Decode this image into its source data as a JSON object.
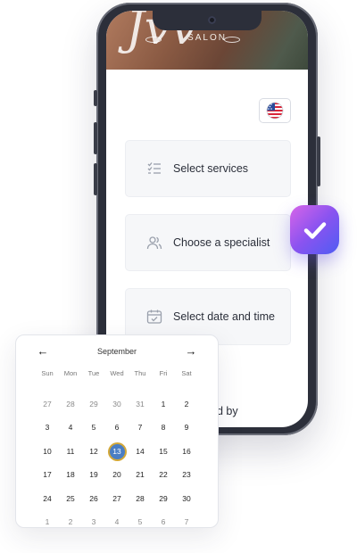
{
  "banner": {
    "script_text": "Jvv",
    "brand": "SALON"
  },
  "steps": [
    {
      "label": "Select services",
      "icon": "list-check-icon"
    },
    {
      "label": "Choose a specialist",
      "icon": "users-icon"
    },
    {
      "label": "Select date and time",
      "icon": "calendar-check-icon"
    }
  ],
  "footer_partial": "d by",
  "language": {
    "flag": "us-flag-icon"
  },
  "calendar": {
    "month": "September",
    "prev": "←",
    "next": "→",
    "weekdays": [
      "Sun",
      "Mon",
      "Tue",
      "Wed",
      "Thu",
      "Fri",
      "Sat"
    ],
    "weeks": [
      [
        {
          "d": "27",
          "m": true
        },
        {
          "d": "28",
          "m": true
        },
        {
          "d": "29",
          "m": true
        },
        {
          "d": "30",
          "m": true
        },
        {
          "d": "31",
          "m": true
        },
        {
          "d": "1"
        },
        {
          "d": "2"
        }
      ],
      [
        {
          "d": "3"
        },
        {
          "d": "4"
        },
        {
          "d": "5"
        },
        {
          "d": "6"
        },
        {
          "d": "7"
        },
        {
          "d": "8"
        },
        {
          "d": "9"
        }
      ],
      [
        {
          "d": "10"
        },
        {
          "d": "11"
        },
        {
          "d": "12"
        },
        {
          "d": "13",
          "sel": true
        },
        {
          "d": "14"
        },
        {
          "d": "15"
        },
        {
          "d": "16"
        }
      ],
      [
        {
          "d": "17"
        },
        {
          "d": "18"
        },
        {
          "d": "19"
        },
        {
          "d": "20"
        },
        {
          "d": "21"
        },
        {
          "d": "22"
        },
        {
          "d": "23"
        }
      ],
      [
        {
          "d": "24"
        },
        {
          "d": "25"
        },
        {
          "d": "26"
        },
        {
          "d": "27"
        },
        {
          "d": "28"
        },
        {
          "d": "29"
        },
        {
          "d": "30"
        }
      ],
      [
        {
          "d": "1",
          "m": true
        },
        {
          "d": "2",
          "m": true
        },
        {
          "d": "3",
          "m": true
        },
        {
          "d": "4",
          "m": true
        },
        {
          "d": "5",
          "m": true
        },
        {
          "d": "6",
          "m": true
        },
        {
          "d": "7",
          "m": true
        }
      ]
    ],
    "selected": "13"
  },
  "colors": {
    "accent_gradient_start": "#d765e8",
    "accent_gradient_end": "#4e5df3",
    "selected_day": "#4a7ec4",
    "selected_ring": "#d3a838"
  }
}
